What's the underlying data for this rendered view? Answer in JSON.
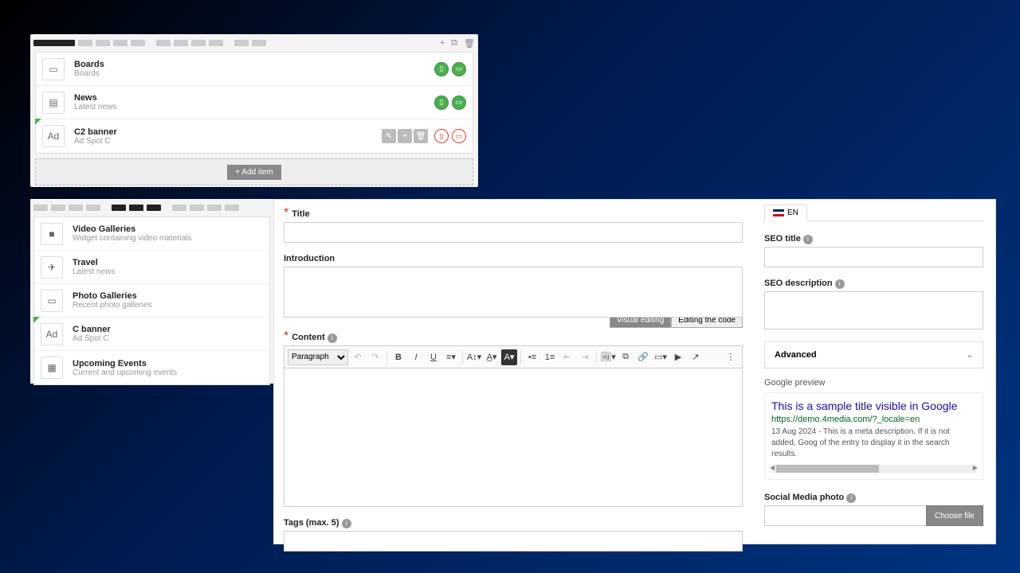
{
  "panel1": {
    "actions": [
      "+",
      "⧉",
      "🗑"
    ],
    "rows": [
      {
        "icon": "▭",
        "title": "Boards",
        "sub": "Boards",
        "badges": [
          "green",
          "green"
        ]
      },
      {
        "icon": "▤",
        "title": "News",
        "sub": "Latest news",
        "badges": [
          "green",
          "green"
        ]
      },
      {
        "icon": "Ad",
        "title": "C2 banner",
        "sub": "Ad Spot C",
        "selected": true,
        "acts": [
          "✎",
          "+",
          "🗑"
        ],
        "badges": [
          "red",
          "red"
        ]
      }
    ],
    "add_label": "+ Add item"
  },
  "panel2": {
    "rows": [
      {
        "icon": "■",
        "title": "Video Galleries",
        "sub": "Widget containing video materials"
      },
      {
        "icon": "✈",
        "title": "Travel",
        "sub": "Latest news"
      },
      {
        "icon": "▭",
        "title": "Photo Galleries",
        "sub": "Recent photo galleries"
      },
      {
        "icon": "Ad",
        "title": "C banner",
        "sub": "Ad Spot C",
        "selected": true
      },
      {
        "icon": "▦",
        "title": "Upcoming Events",
        "sub": "Current and upcoming events"
      }
    ]
  },
  "form": {
    "title_label": "Title",
    "intro_label": "Introduction",
    "content_label": "Content",
    "visual_tab": "Visual editing",
    "code_tab": "Editing the code",
    "paragraph": "Paragraph",
    "tags_label": "Tags (max. 5)"
  },
  "side": {
    "lang": "EN",
    "seo_title_label": "SEO title",
    "seo_desc_label": "SEO description",
    "advanced_label": "Advanced",
    "gprev_label": "Google preview",
    "g_title": "This is a sample title visible in Google",
    "g_url": "https://demo.4media.com/?_locale=en",
    "g_desc": "13 Aug 2024 - This is a meta description. If it is not added, Goog of the entry to display it in the search results.",
    "social_label": "Social Media photo",
    "choose_file": "Choose file"
  }
}
